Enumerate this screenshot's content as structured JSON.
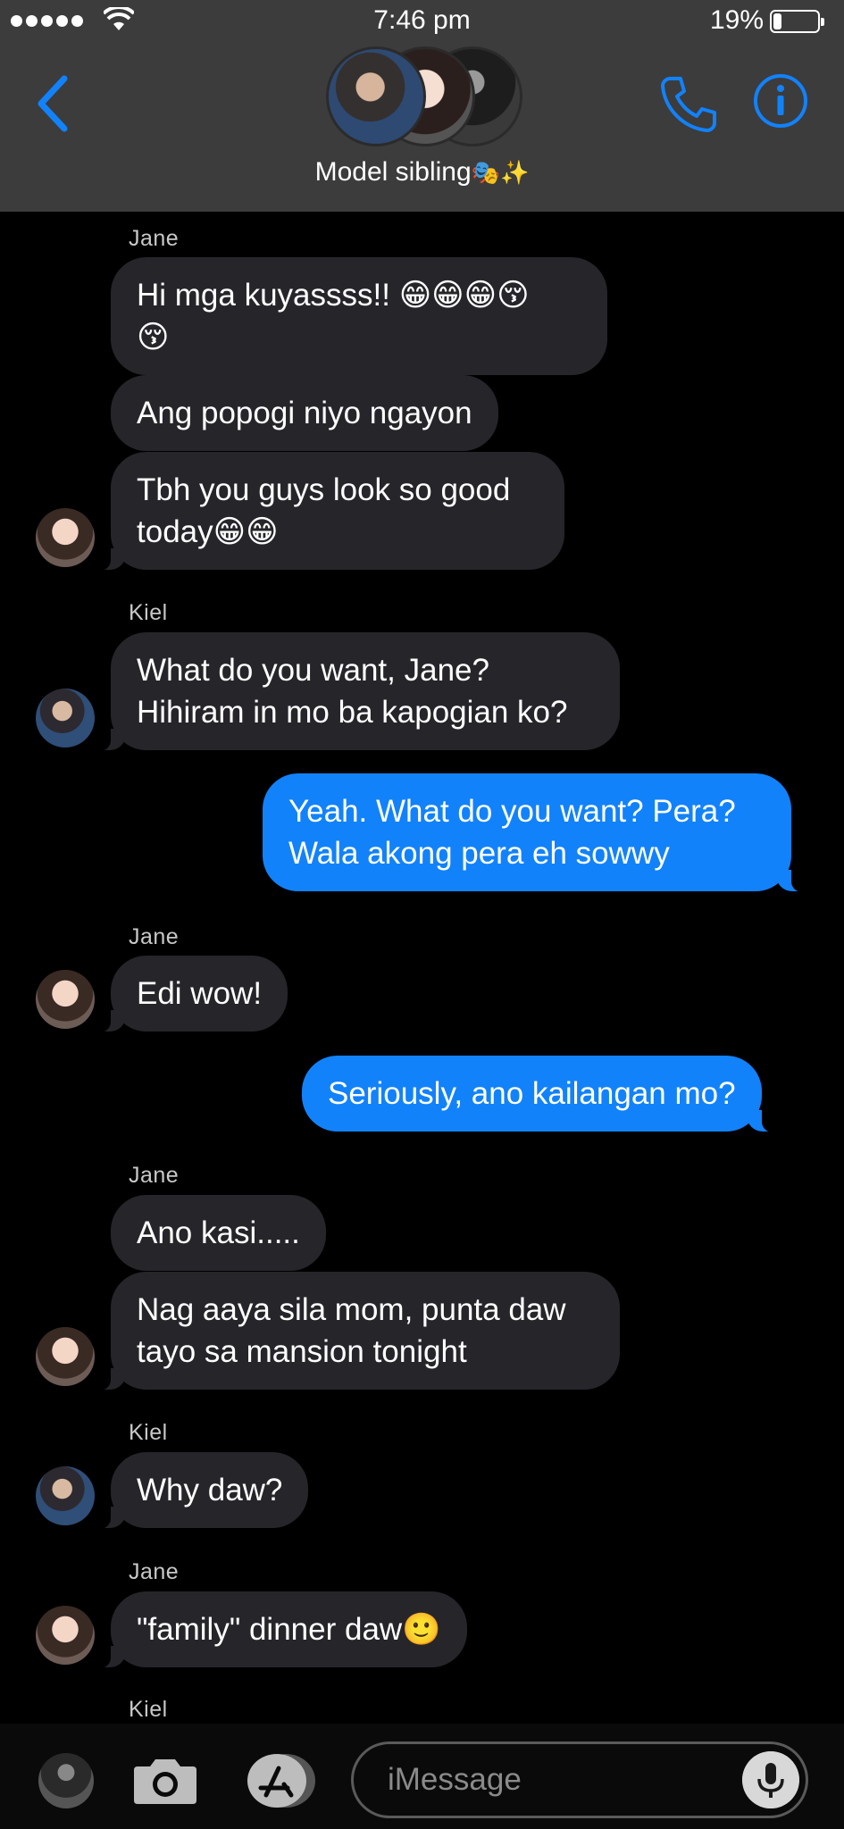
{
  "status_bar": {
    "time": "7:46 pm",
    "battery_percent": "19%",
    "battery_level": 0.19,
    "signal_dots": 5
  },
  "header": {
    "title": "Model sibling",
    "title_emoji": "🎭✨",
    "back_icon": "chevron-left-icon",
    "call_icon": "phone-icon",
    "info_icon": "info-icon",
    "accent_color": "#1282fb"
  },
  "conversation": {
    "senders": [
      "Jane",
      "Kiel",
      "Jane",
      "Jane",
      "Kiel",
      "Jane",
      "Kiel"
    ],
    "messages": [
      "Hi mga kuyassss!! 😁😁😁😚",
      "😚",
      "Ang popogi niyo ngayon",
      "Tbh you guys look so good",
      "today😁😁",
      "What do you want, Jane?",
      "Hihiram in mo ba kapogian ko?",
      "Yeah. What do you want? Pera?",
      "Wala akong pera eh sowwy",
      "Edi wow!",
      "Seriously, ano kailangan mo?",
      "Ano kasi.....",
      "Nag aaya sila mom, punta daw",
      "tayo sa mansion tonight",
      "Why daw?",
      "\"family\" dinner daw🙂"
    ],
    "incoming_bubble_color": "#26252a",
    "outgoing_bubble_color": "#1282fb"
  },
  "input_bar": {
    "placeholder": "iMessage",
    "camera_icon": "camera-icon",
    "apps_icon": "app-store-icon",
    "mic_icon": "microphone-icon"
  }
}
